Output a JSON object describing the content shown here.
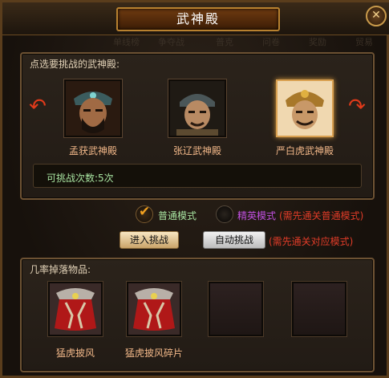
{
  "window": {
    "title": "武神殿",
    "close_glyph": "✕"
  },
  "ghost_tabs": [
    "单线榜",
    "争夺战",
    "普克",
    "问卷",
    "奖励",
    "贸易"
  ],
  "select_panel": {
    "label": "点选要挑战的武神殿:",
    "heroes": [
      {
        "name": "孟获武神殿",
        "icon": "meng-huo-portrait-icon",
        "selected": false
      },
      {
        "name": "张辽武神殿",
        "icon": "zhang-liao-portrait-icon",
        "selected": false
      },
      {
        "name": "严白虎武神殿",
        "icon": "yan-baihu-portrait-icon",
        "selected": true
      }
    ],
    "challenge_count": "可挑战次数:5次"
  },
  "modes": {
    "normal_label": "普通模式",
    "elite_label": "精英模式",
    "elite_note": "(需先通关普通模式)"
  },
  "actions": {
    "enter_label": "进入挑战",
    "auto_label": "自动挑战",
    "auto_note": "(需先通关对应模式)"
  },
  "drops_panel": {
    "label": "几率掉落物品:",
    "items": [
      {
        "name": "猛虎披风",
        "icon": "red-cloak-icon"
      },
      {
        "name": "猛虎披风碎片",
        "icon": "red-cloak-icon"
      },
      {
        "name": "",
        "icon": ""
      },
      {
        "name": "",
        "icon": ""
      }
    ]
  },
  "colors": {
    "hero_name": "#f2b889",
    "count_text": "#a7e3a0",
    "normal_mode": "#a7e3a0",
    "elite_mode": "#c050e0",
    "note_red": "#e03c28",
    "arrow_red": "#e03a1a"
  }
}
